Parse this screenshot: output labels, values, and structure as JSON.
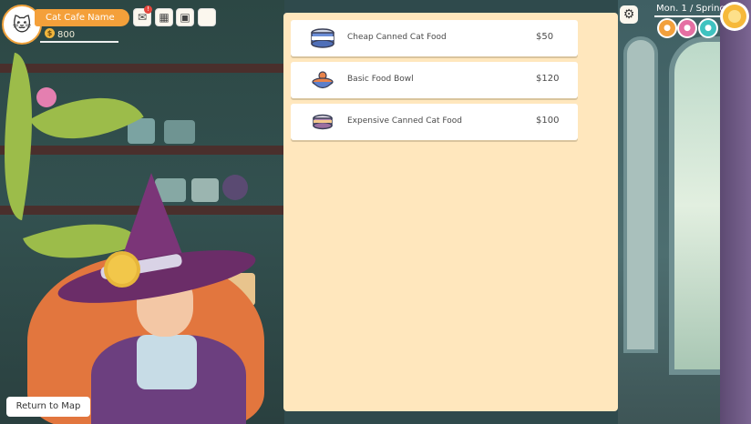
{
  "hud": {
    "logo_icon": "cat-logo-icon",
    "cafe_name": "Cat Cafe Name",
    "coins": "800",
    "mail_alert": "!",
    "buttons": [
      "mail-icon",
      "calendar-icon",
      "backpack-icon",
      "blank-icon"
    ]
  },
  "clock": {
    "date": "Mon. 1 / Spring"
  },
  "shop": {
    "items": [
      {
        "name": "Cheap Canned Cat Food",
        "price": "$50",
        "icon": "canned-food-icon"
      },
      {
        "name": "Basic Food Bowl",
        "price": "$120",
        "icon": "food-bowl-icon"
      },
      {
        "name": "Expensive Canned Cat Food",
        "price": "$100",
        "icon": "premium-can-icon"
      }
    ]
  },
  "actions": {
    "return_label": "Return to Map"
  },
  "colors": {
    "panel": "#ffe7bd",
    "accent": "#f4a03a",
    "alert": "#e5453c"
  }
}
